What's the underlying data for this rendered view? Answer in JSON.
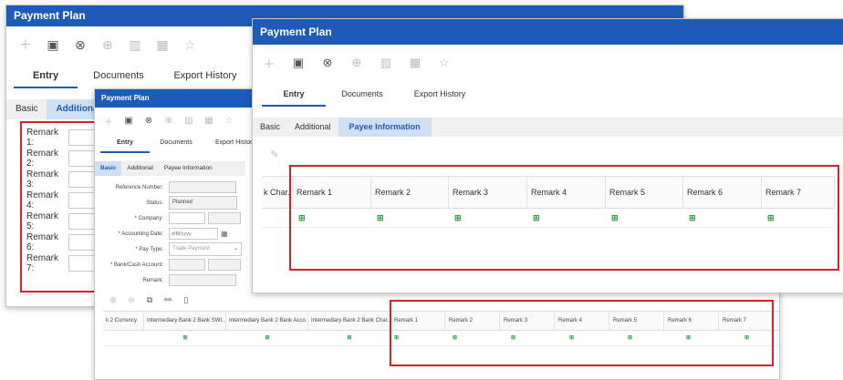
{
  "window_title": "Payment Plan",
  "toolbar_icons": [
    "add-icon",
    "save-icon",
    "cancel-icon",
    "submit-icon",
    "delete-icon",
    "calculator-icon",
    "star-icon"
  ],
  "main_tabs": [
    "Entry",
    "Documents",
    "Export History"
  ],
  "sub_tabs": [
    "Basic",
    "Additional",
    "Payee Information"
  ],
  "back": {
    "subtabs_visible": [
      "Basic",
      "Additiona"
    ],
    "remarks": [
      "Remark 1:",
      "Remark 2:",
      "Remark 3:",
      "Remark 4:",
      "Remark 5:",
      "Remark 6:",
      "Remark 7:"
    ]
  },
  "form": {
    "reference_number_label": "Reference Number:",
    "status_label": "Status:",
    "status_value": "Planned",
    "company_label": "* Company:",
    "accounting_date_label": "* Accounting Date:",
    "accounting_date_placeholder": "d/M/yyyy",
    "pay_type_label": "* Pay Type:",
    "pay_type_value": "Trade Payment",
    "bank_cash_account_label": "* Bank/Cash Account:",
    "remark_label": "Remark:"
  },
  "middle_table": {
    "columns": [
      "k 2 Currency",
      "Intermediary Bank 2 Bank SWI...",
      "Intermediary Bank 2 Bank Acco...",
      "Intermediary Bank 2 Bank Char...",
      "Remark 1",
      "Remark 2",
      "Remark 3",
      "Remark 4",
      "Remark 5",
      "Remark 6",
      "Remark 7"
    ]
  },
  "front_table": {
    "columns": [
      "k Char...",
      "Remark 1",
      "Remark 2",
      "Remark 3",
      "Remark 4",
      "Remark 5",
      "Remark 6",
      "Remark 7"
    ]
  },
  "colors": {
    "title_blue": "#1e5bb8",
    "highlight_red": "#d3232a",
    "plus_green": "#2f9e44"
  }
}
